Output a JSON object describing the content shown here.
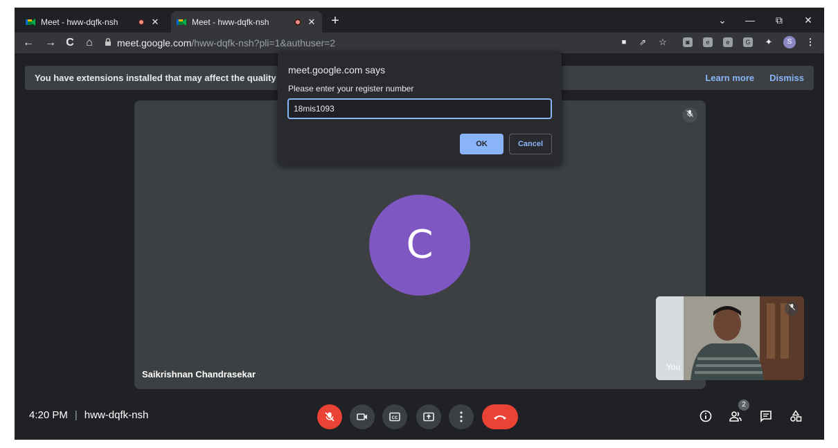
{
  "browser": {
    "tabs": [
      {
        "title": "Meet - hww-dqfk-nsh",
        "favicon": "google-meet-icon",
        "recording": true,
        "close": "✕"
      },
      {
        "title": "Meet - hww-dqfk-nsh",
        "favicon": "google-meet-icon",
        "recording": true,
        "close": "✕"
      }
    ],
    "new_tab": "+",
    "window_controls": {
      "dropdown": "⌄",
      "minimize": "—",
      "restore": "⧉",
      "close": "✕"
    },
    "nav": {
      "back": "←",
      "forward": "→",
      "reload": "C",
      "home": "⌂"
    },
    "url_host": "meet.google.com",
    "url_path": "/hww-dqfk-nsh?pli=1&authuser=2",
    "profile_initial": "S"
  },
  "banner": {
    "text": "You have extensions installed that may affect the quality c",
    "learn_more": "Learn more",
    "dismiss": "Dismiss"
  },
  "main_tile": {
    "avatar_letter": "C",
    "name": "Saikrishnan Chandrasekar",
    "avatar_color": "#7e57c2"
  },
  "self_tile": {
    "label": "You"
  },
  "bottom_bar": {
    "time": "4:20 PM",
    "meeting_code": "hww-dqfk-nsh",
    "participant_count": "2"
  },
  "dialog": {
    "title": "meet.google.com says",
    "message": "Please enter your register number",
    "input_value": "18mis1093",
    "ok_label": "OK",
    "cancel_label": "Cancel"
  },
  "colors": {
    "accent": "#8ab4f8",
    "danger": "#ea4335",
    "surface": "#202124",
    "tile": "#3c4043"
  }
}
